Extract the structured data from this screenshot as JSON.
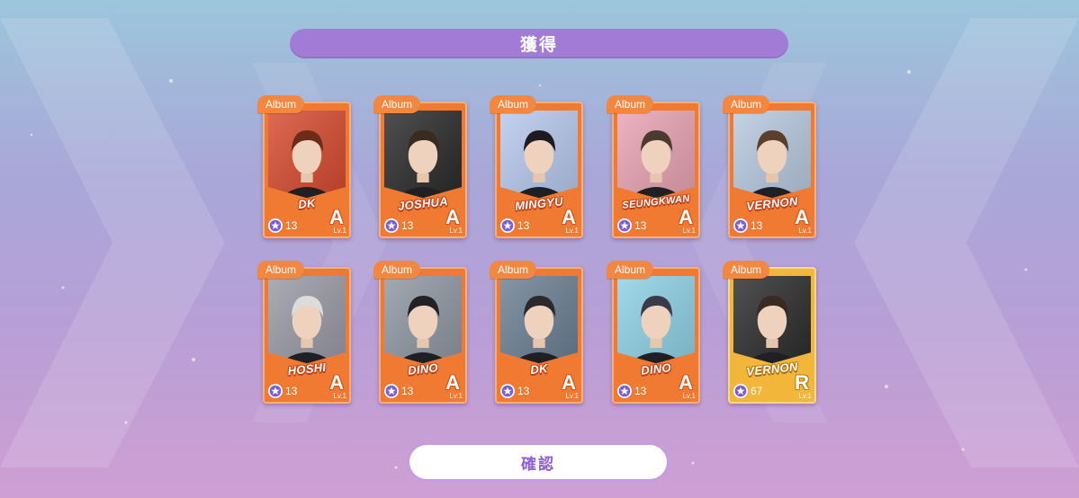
{
  "header": {
    "title": "獲得"
  },
  "footer": {
    "confirm_label": "確認"
  },
  "cards": [
    {
      "tag": "Album",
      "name": "DK",
      "level": "13",
      "rank": "A",
      "lv": "Lv.1",
      "style": "orange",
      "photo_tone": "#d64a2f",
      "hair": "#6b2c18"
    },
    {
      "tag": "Album",
      "name": "JOSHUA",
      "level": "13",
      "rank": "A",
      "lv": "Lv.1",
      "style": "orange",
      "photo_tone": "#2a2a2a",
      "hair": "#3a2a20"
    },
    {
      "tag": "Album",
      "name": "MINGYU",
      "level": "13",
      "rank": "A",
      "lv": "Lv.1",
      "style": "orange",
      "photo_tone": "#b8c8ee",
      "hair": "#1e1a22"
    },
    {
      "tag": "Album",
      "name": "SEUNGKWAN",
      "level": "13",
      "rank": "A",
      "lv": "Lv.1",
      "style": "orange",
      "photo_tone": "#e9a3b3",
      "hair": "#4a3a30"
    },
    {
      "tag": "Album",
      "name": "VERNON",
      "level": "13",
      "rank": "A",
      "lv": "Lv.1",
      "style": "orange",
      "photo_tone": "#b7c9df",
      "hair": "#5a3f2a"
    },
    {
      "tag": "Album",
      "name": "HOSHI",
      "level": "13",
      "rank": "A",
      "lv": "Lv.1",
      "style": "orange",
      "photo_tone": "#9a9aa6",
      "hair": "#dcdcdc"
    },
    {
      "tag": "Album",
      "name": "DINO",
      "level": "13",
      "rank": "A",
      "lv": "Lv.1",
      "style": "orange",
      "photo_tone": "#8e97a2",
      "hair": "#222226"
    },
    {
      "tag": "Album",
      "name": "DK",
      "level": "13",
      "rank": "A",
      "lv": "Lv.1",
      "style": "orange",
      "photo_tone": "#6b7f94",
      "hair": "#2a2a2e"
    },
    {
      "tag": "Album",
      "name": "DINO",
      "level": "13",
      "rank": "A",
      "lv": "Lv.1",
      "style": "orange",
      "photo_tone": "#8fd1e6",
      "hair": "#3a3a48"
    },
    {
      "tag": "Album",
      "name": "VERNON",
      "level": "67",
      "rank": "R",
      "lv": "Lv.1",
      "style": "gold",
      "photo_tone": "#2c2c2c",
      "hair": "#3a2a22"
    }
  ],
  "colors": {
    "accent": "#a27bd6",
    "card_orange": "#f07a32",
    "card_gold": "#f1b63a"
  },
  "icons": {
    "level_badge": "star-icon"
  }
}
